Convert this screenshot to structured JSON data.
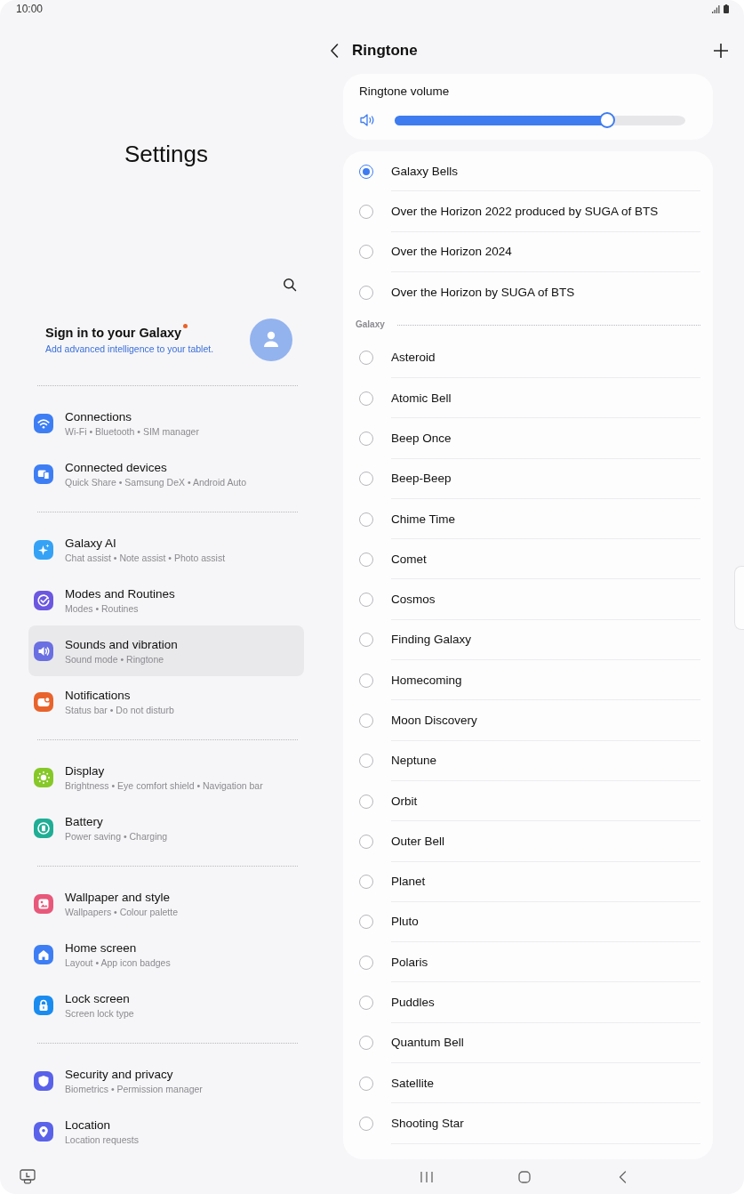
{
  "status_bar": {
    "time": "10:00"
  },
  "settings": {
    "title": "Settings",
    "account": {
      "title": "Sign in to your Galaxy",
      "subtitle": "Add advanced intelligence to your tablet.",
      "badge": true
    },
    "groups": [
      {
        "items": [
          {
            "title": "Connections",
            "subtitle": "Wi-Fi • Bluetooth • SIM manager",
            "color": "#3e7ef4",
            "selected": false
          },
          {
            "title": "Connected devices",
            "subtitle": "Quick Share • Samsung DeX • Android Auto",
            "color": "#3e7ef4",
            "selected": false
          }
        ]
      },
      {
        "items": [
          {
            "title": "Galaxy AI",
            "subtitle": "Chat assist • Note assist • Photo assist",
            "color": "#35a2f5",
            "selected": false
          },
          {
            "title": "Modes and Routines",
            "subtitle": "Modes • Routines",
            "color": "#6b57e0",
            "selected": false
          },
          {
            "title": "Sounds and vibration",
            "subtitle": "Sound mode • Ringtone",
            "color": "#6a6fe2",
            "selected": true
          },
          {
            "title": "Notifications",
            "subtitle": "Status bar • Do not disturb",
            "color": "#e9642c",
            "selected": false
          }
        ]
      },
      {
        "items": [
          {
            "title": "Display",
            "subtitle": "Brightness • Eye comfort shield • Navigation bar",
            "color": "#86c828",
            "selected": false
          },
          {
            "title": "Battery",
            "subtitle": "Power saving • Charging",
            "color": "#1fae95",
            "selected": false
          }
        ]
      },
      {
        "items": [
          {
            "title": "Wallpaper and style",
            "subtitle": "Wallpapers • Colour palette",
            "color": "#e8587a",
            "selected": false
          },
          {
            "title": "Home screen",
            "subtitle": "Layout • App icon badges",
            "color": "#3e7ef4",
            "selected": false
          },
          {
            "title": "Lock screen",
            "subtitle": "Screen lock type",
            "color": "#1a8cf0",
            "selected": false
          }
        ]
      },
      {
        "items": [
          {
            "title": "Security and privacy",
            "subtitle": "Biometrics • Permission manager",
            "color": "#5a62ea",
            "selected": false
          },
          {
            "title": "Location",
            "subtitle": "Location requests",
            "color": "#5a62ea",
            "selected": false
          }
        ]
      }
    ]
  },
  "ringtone": {
    "title": "Ringtone",
    "volume": {
      "label": "Ringtone volume",
      "level": 0.73
    },
    "list": {
      "items": [
        {
          "title": "Galaxy Bells",
          "selected": true
        },
        {
          "title": "Over the Horizon 2022 produced by SUGA of BTS",
          "selected": false
        },
        {
          "title": "Over the Horizon 2024",
          "selected": false
        },
        {
          "title": "Over the Horizon by SUGA of BTS",
          "selected": false
        }
      ],
      "sections": [
        {
          "header": "Galaxy",
          "items": [
            {
              "title": "Asteroid",
              "selected": false
            },
            {
              "title": "Atomic Bell",
              "selected": false
            },
            {
              "title": "Beep Once",
              "selected": false
            },
            {
              "title": "Beep-Beep",
              "selected": false
            },
            {
              "title": "Chime Time",
              "selected": false
            },
            {
              "title": "Comet",
              "selected": false
            },
            {
              "title": "Cosmos",
              "selected": false
            },
            {
              "title": "Finding Galaxy",
              "selected": false
            },
            {
              "title": "Homecoming",
              "selected": false
            },
            {
              "title": "Moon Discovery",
              "selected": false
            },
            {
              "title": "Neptune",
              "selected": false
            },
            {
              "title": "Orbit",
              "selected": false
            },
            {
              "title": "Outer Bell",
              "selected": false
            },
            {
              "title": "Planet",
              "selected": false
            },
            {
              "title": "Pluto",
              "selected": false
            },
            {
              "title": "Polaris",
              "selected": false
            },
            {
              "title": "Puddles",
              "selected": false
            },
            {
              "title": "Quantum Bell",
              "selected": false
            },
            {
              "title": "Satellite",
              "selected": false
            },
            {
              "title": "Shooting Star",
              "selected": false
            }
          ]
        }
      ]
    }
  }
}
